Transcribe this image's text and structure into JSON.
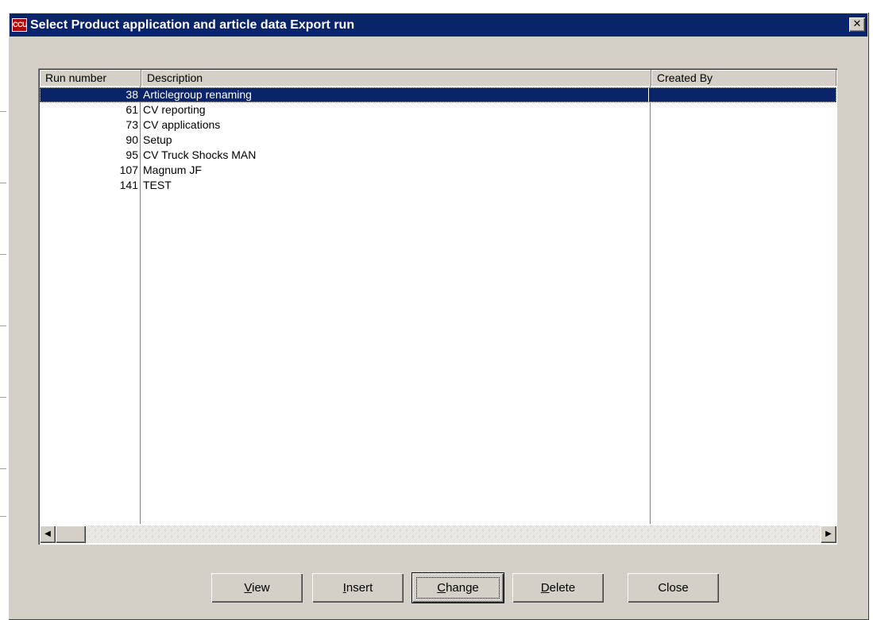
{
  "dialog": {
    "title": "Select Product application and article data Export run",
    "icon_text": "CCU",
    "close_glyph": "✕"
  },
  "list": {
    "columns": [
      "Run number",
      "Description",
      "Created By"
    ],
    "rows": [
      {
        "run": "38",
        "description": "Articlegroup renaming",
        "created_by": "",
        "selected": true
      },
      {
        "run": "61",
        "description": "CV reporting",
        "created_by": ""
      },
      {
        "run": "73",
        "description": "CV applications",
        "created_by": ""
      },
      {
        "run": "90",
        "description": "Setup",
        "created_by": ""
      },
      {
        "run": "95",
        "description": "CV Truck Shocks MAN",
        "created_by": ""
      },
      {
        "run": "107",
        "description": "Magnum JF",
        "created_by": ""
      },
      {
        "run": "141",
        "description": "TEST",
        "created_by": ""
      }
    ]
  },
  "scrollbar": {
    "left_arrow": "◀",
    "right_arrow": "▶"
  },
  "buttons": {
    "view": {
      "accel": "V",
      "rest": "iew"
    },
    "insert": {
      "accel": "I",
      "rest": "nsert"
    },
    "change": {
      "accel": "C",
      "rest": "hange"
    },
    "delete": {
      "accel": "D",
      "rest": "elete"
    },
    "close": {
      "label": "Close"
    }
  },
  "colors": {
    "title_bar": "#0a246a",
    "dialog_face": "#d4d0c8",
    "selection": "#0a246a"
  }
}
